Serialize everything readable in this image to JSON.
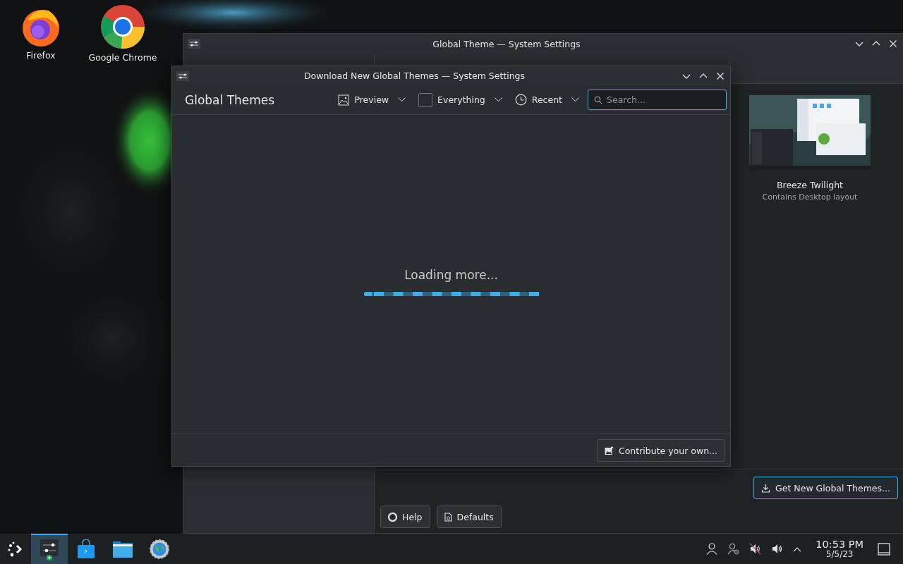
{
  "desktop": {
    "icons": [
      {
        "label": "Firefox",
        "kind": "firefox"
      },
      {
        "label": "Google Chrome",
        "kind": "chrome"
      }
    ]
  },
  "main_window": {
    "title": "Global Theme — System Settings",
    "theme_card": {
      "name": "Breeze Twilight",
      "description": "Contains Desktop layout"
    },
    "get_new_button": {
      "label": "Get New Global Themes...",
      "focused": true
    },
    "buttons": [
      {
        "label": "Help",
        "kind": "help"
      },
      {
        "label": "Defaults",
        "kind": "defaults"
      }
    ]
  },
  "dialog": {
    "title": "Download New Global Themes — System Settings",
    "heading": "Global Themes",
    "filters": [
      {
        "label": "Preview",
        "kind": "preview"
      },
      {
        "label": "Everything",
        "kind": "category"
      },
      {
        "label": "Recent",
        "kind": "sort"
      }
    ],
    "search": {
      "placeholder": "Search..."
    },
    "status": "Loading more...",
    "footer_button": "Contribute your own..."
  },
  "taskbar": {
    "apps": [
      {
        "kind": "launcher",
        "selected": false
      },
      {
        "kind": "settings",
        "selected": true
      },
      {
        "kind": "store",
        "selected": false
      },
      {
        "kind": "folder",
        "selected": false
      },
      {
        "kind": "globe",
        "selected": false
      }
    ],
    "tray": [
      {
        "kind": "user"
      },
      {
        "kind": "user-status"
      },
      {
        "kind": "muted"
      },
      {
        "kind": "volume"
      },
      {
        "kind": "expand"
      }
    ],
    "time": "10:53 PM",
    "date": "5/5/23"
  }
}
